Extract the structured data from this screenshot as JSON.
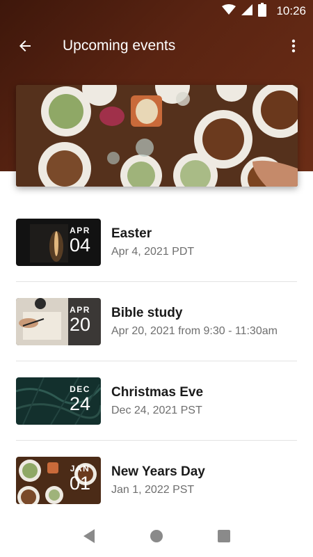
{
  "status_bar": {
    "time": "10:26"
  },
  "app_bar": {
    "title": "Upcoming events"
  },
  "events": [
    {
      "month": "APR",
      "day": "04",
      "title": "Easter",
      "subtitle": "Apr 4, 2021 PDT"
    },
    {
      "month": "APR",
      "day": "20",
      "title": "Bible study",
      "subtitle": "Apr 20, 2021 from 9:30 - 11:30am"
    },
    {
      "month": "DEC",
      "day": "24",
      "title": "Christmas Eve",
      "subtitle": "Dec 24, 2021 PST"
    },
    {
      "month": "JAN",
      "day": "01",
      "title": "New Years Day",
      "subtitle": "Jan 1, 2022 PST"
    }
  ],
  "colors": {
    "header": "#5a2412",
    "title_text": "#1a1a1a",
    "subtitle_text": "#6e6e6e"
  }
}
